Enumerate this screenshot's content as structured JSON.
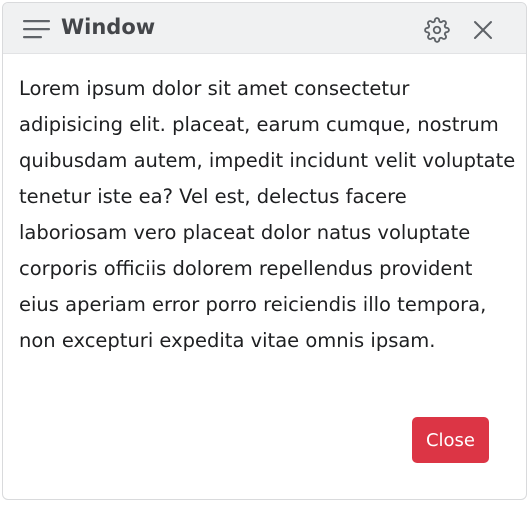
{
  "window": {
    "title": "Window",
    "menu_icon": "hamburger-menu-icon",
    "settings_icon": "gear-icon",
    "close_icon": "close-icon"
  },
  "content": {
    "text": "Lorem ipsum dolor sit amet consectetur adipisicing elit. placeat, earum cumque, nostrum quibusdam autem, impedit incidunt velit voluptate tenetur iste ea? Vel est, delectus facere laboriosam vero placeat dolor natus voluptate corporis officiis dolorem repellendus provident eius aperiam error porro reiciendis illo tempora, non excepturi expedita vitae omnis ipsam."
  },
  "footer": {
    "close_label": "Close"
  },
  "colors": {
    "titlebar_bg": "#f0f1f2",
    "close_button_bg": "#dc3545",
    "icon_color": "#5f6368"
  }
}
